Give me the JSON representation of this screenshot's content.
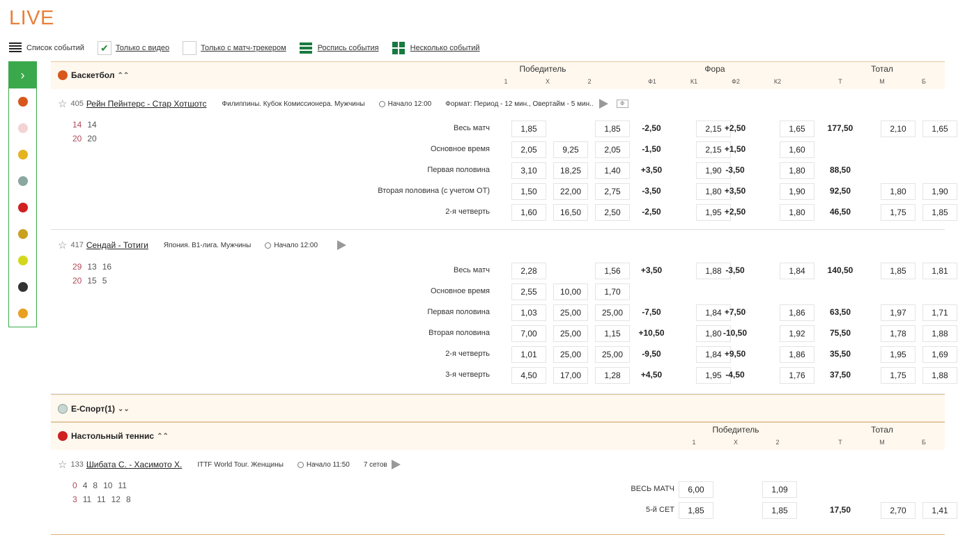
{
  "page": {
    "title": "LIVE"
  },
  "filters": [
    {
      "icon": "list-icon",
      "label": "Список событий"
    },
    {
      "icon": "checkbox-checked",
      "label": "Только с видео"
    },
    {
      "icon": "checkbox-empty",
      "label": "Только с матч-трекером"
    },
    {
      "icon": "rows-icon",
      "label": "Роспись события"
    },
    {
      "icon": "grid-icon",
      "label": "Несколько событий"
    }
  ],
  "sidebar": {
    "expand": "›",
    "sports": [
      {
        "icon": "basketball-icon",
        "color": "#d8571c"
      },
      {
        "icon": "baseball-icon",
        "color": "#f3d3d3"
      },
      {
        "icon": "volleyball-icon",
        "color": "#e3b320"
      },
      {
        "icon": "esports-icon",
        "color": "#8aa8a0"
      },
      {
        "icon": "table-tennis-icon",
        "color": "#d02020"
      },
      {
        "icon": "american-football-icon",
        "color": "#c9a020"
      },
      {
        "icon": "tennis-icon",
        "color": "#d4d81c"
      },
      {
        "icon": "football-icon",
        "color": "#333333"
      },
      {
        "icon": "other-sport-icon",
        "color": "#e8a020"
      }
    ]
  },
  "basketball": {
    "name": "Баскетбол",
    "groups": {
      "winner": "Победитель",
      "fora": "Фора",
      "total": "Тотал"
    },
    "cols": [
      "1",
      "X",
      "2",
      "Ф1",
      "К1",
      "Ф2",
      "К2",
      "Т",
      "М",
      "Б"
    ],
    "events": [
      {
        "num": "405",
        "teams": "Рейн Пейнтерс - Стар Хотшотс",
        "league": "Филиппины. Кубок Комиссионера. Мужчины",
        "start": "Начало 12:00",
        "format": "Формат: Период - 12 мин., Овертайм - 5 мин..",
        "box": "Ф",
        "score": [
          [
            "14",
            "14"
          ],
          [
            "20",
            "20"
          ]
        ],
        "rows": [
          {
            "label": "Весь матч",
            "w1": "1,85",
            "x": "",
            "w2": "1,85",
            "f1": "-2,50",
            "k1": "2,15",
            "f2": "+2,50",
            "k2": "1,65",
            "t": "177,50",
            "m": "2,10",
            "b": "1,65"
          },
          {
            "label": "Основное время",
            "w1": "2,05",
            "x": "9,25",
            "w2": "2,05",
            "f1": "-1,50",
            "k1": "2,15",
            "f2": "+1,50",
            "k2": "1,60",
            "t": "",
            "m": "",
            "b": ""
          },
          {
            "label": "Первая половина",
            "w1": "3,10",
            "x": "18,25",
            "w2": "1,40",
            "f1": "+3,50",
            "k1": "1,90",
            "f2": "-3,50",
            "k2": "1,80",
            "t": "88,50",
            "m": "",
            "b": ""
          },
          {
            "label": "Вторая половина (с учетом ОТ)",
            "w1": "1,50",
            "x": "22,00",
            "w2": "2,75",
            "f1": "-3,50",
            "k1": "1,80",
            "f2": "+3,50",
            "k2": "1,90",
            "t": "92,50",
            "m": "1,80",
            "b": "1,90"
          },
          {
            "label": "2-я четверть",
            "w1": "1,60",
            "x": "16,50",
            "w2": "2,50",
            "f1": "-2,50",
            "k1": "1,95",
            "f2": "+2,50",
            "k2": "1,80",
            "t": "46,50",
            "m": "1,75",
            "b": "1,85"
          }
        ]
      },
      {
        "num": "417",
        "teams": "Сендай - Тотиги",
        "league": "Япония. B1-лига. Мужчины",
        "start": "Начало 12:00",
        "format": "",
        "box": "",
        "score": [
          [
            "29",
            "13",
            "16"
          ],
          [
            "20",
            "15",
            "5"
          ]
        ],
        "rows": [
          {
            "label": "Весь матч",
            "w1": "2,28",
            "x": "",
            "w2": "1,56",
            "f1": "+3,50",
            "k1": "1,88",
            "f2": "-3,50",
            "k2": "1,84",
            "t": "140,50",
            "m": "1,85",
            "b": "1,81"
          },
          {
            "label": "Основное время",
            "w1": "2,55",
            "x": "10,00",
            "w2": "1,70",
            "f1": "",
            "k1": "",
            "f2": "",
            "k2": "",
            "t": "",
            "m": "",
            "b": ""
          },
          {
            "label": "Первая половина",
            "w1": "1,03",
            "x": "25,00",
            "w2": "25,00",
            "f1": "-7,50",
            "k1": "1,84",
            "f2": "+7,50",
            "k2": "1,86",
            "t": "63,50",
            "m": "1,97",
            "b": "1,71"
          },
          {
            "label": "Вторая половина",
            "w1": "7,00",
            "x": "25,00",
            "w2": "1,15",
            "f1": "+10,50",
            "k1": "1,80",
            "f2": "-10,50",
            "k2": "1,92",
            "t": "75,50",
            "m": "1,78",
            "b": "1,88"
          },
          {
            "label": "2-я четверть",
            "w1": "1,01",
            "x": "25,00",
            "w2": "25,00",
            "f1": "-9,50",
            "k1": "1,84",
            "f2": "+9,50",
            "k2": "1,86",
            "t": "35,50",
            "m": "1,95",
            "b": "1,69"
          },
          {
            "label": "3-я четверть",
            "w1": "4,50",
            "x": "17,00",
            "w2": "1,28",
            "f1": "+4,50",
            "k1": "1,95",
            "f2": "-4,50",
            "k2": "1,76",
            "t": "37,50",
            "m": "1,75",
            "b": "1,88"
          }
        ]
      }
    ]
  },
  "esport": {
    "name": "E-Спорт(1)"
  },
  "tabletennis": {
    "name": "Настольный теннис",
    "groups": {
      "winner": "Победитель",
      "total": "Тотал"
    },
    "cols": [
      "1",
      "X",
      "2",
      "Т",
      "М",
      "Б"
    ],
    "event": {
      "num": "133",
      "teams": "Шибата С. - Хасимото Х.",
      "league": "ITTF World Tour. Женщины",
      "start": "Начало 11:50",
      "format": "7 сетов",
      "score": [
        [
          "0",
          "4",
          "8",
          "10",
          "11"
        ],
        [
          "3",
          "11",
          "11",
          "12",
          "8"
        ]
      ],
      "rows": [
        {
          "label": "ВЕСЬ МАТЧ",
          "w1": "6,00",
          "w2": "1,09",
          "t": "",
          "m": "",
          "b": ""
        },
        {
          "label": "5-й СЕТ",
          "w1": "1,85",
          "w2": "1,85",
          "t": "17,50",
          "m": "2,70",
          "b": "1,41"
        }
      ]
    }
  }
}
